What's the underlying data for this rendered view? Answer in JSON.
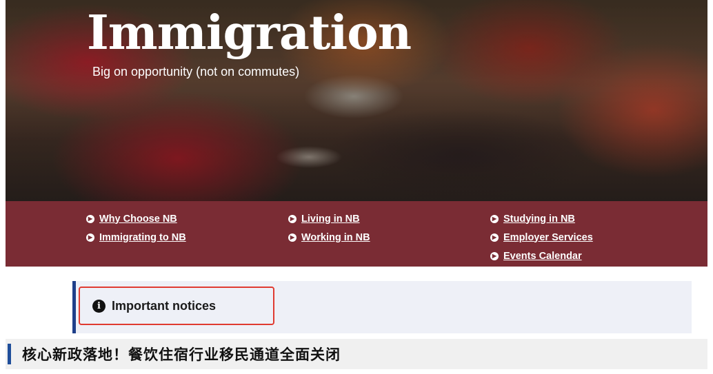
{
  "hero": {
    "title": "Immigration",
    "subtitle": "Big on opportunity (not on commutes)"
  },
  "nav": {
    "col1": [
      "Why Choose NB",
      "Immigrating to NB"
    ],
    "col2": [
      "Living in NB",
      "Working in NB"
    ],
    "col3": [
      "Studying in NB",
      "Employer Services",
      "Events Calendar"
    ],
    "bullet_icon": "circle-arrow-right-icon"
  },
  "notice": {
    "title": "Important notices",
    "icon": "info-circle-icon"
  },
  "headline": {
    "text": "核心新政落地！餐饮住宿行业移民通道全面关闭"
  },
  "colors": {
    "nav_band": "#7a2c34",
    "notice_border": "#1f3f8a",
    "highlight": "#e03a30",
    "headline_accent": "#1f4e9a"
  }
}
